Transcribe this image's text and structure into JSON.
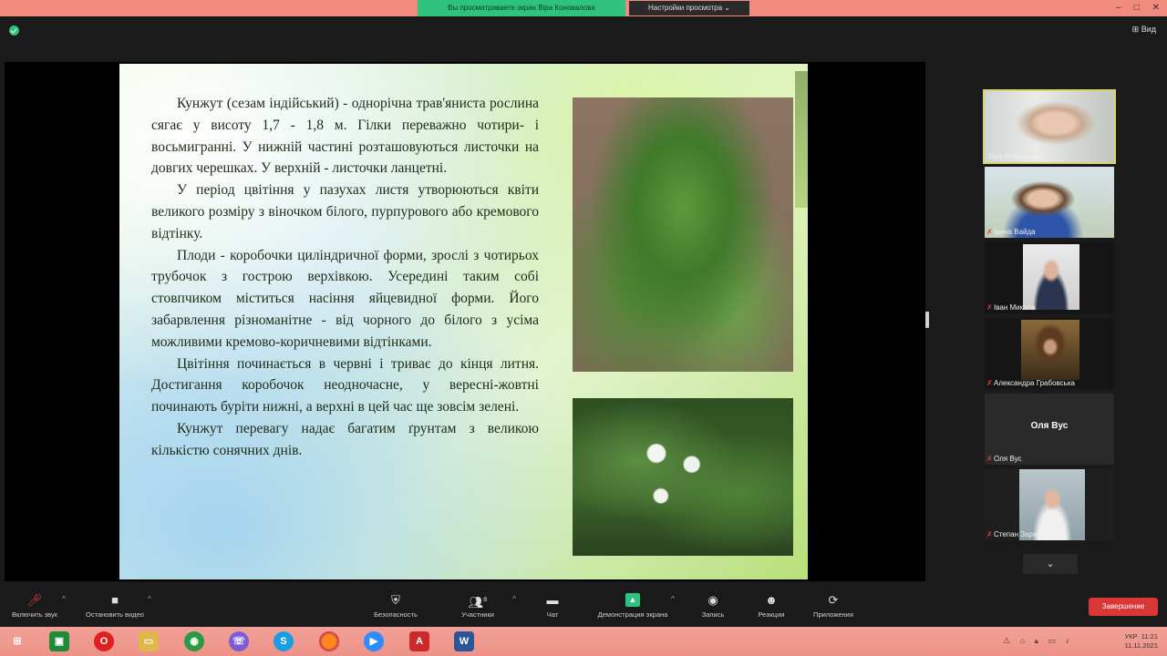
{
  "topbar": {
    "share_banner": "Вы просматриваете экран Віра Коновалова",
    "view_options": "Настройки просмотра",
    "view_options_caret": "⌄",
    "window_controls": [
      "–",
      "□",
      "✕"
    ]
  },
  "zoom": {
    "view_label": "⊞ Вид"
  },
  "slide": {
    "paragraphs": [
      "Кунжут (сезам індійський) - однорічна трав'яниста рослина сягає у висоту 1,7 - 1,8 м. Гілки переважно чотири- і восьмигранні. У нижній частині розташовуються листочки на довгих черешках. У верхній - листочки ланцетні.",
      "У період цвітіння у пазухах листя утворюються квіти великого розміру з віночком білого, пурпурового або кремового відтінку.",
      "Плоди - коробочки циліндричної форми, зрослі з чотирьох трубочок з гострою верхівкою. Усередині таким собі стовпчиком міститься насіння яйцевидної форми.   Його забарвлення різноманітне - від чорного до білого з усіма можливими кремово-коричневими відтінками.",
      "Цвітіння починається в червні і триває до кінця литня. Достигання коробочок неодночасне, у вересні-жовтні починають буріти нижні, а верхні в цей час ще зовсім зелені.",
      "Кунжут перевагу надає багатим ґрунтам з великою кількістю сонячних днів."
    ]
  },
  "participants": [
    {
      "name": "Віра Коновалова",
      "active": true,
      "muted": false
    },
    {
      "name": "Ірина Вайда",
      "active": false,
      "muted": true
    },
    {
      "name": "Іван Микола",
      "active": false,
      "muted": true
    },
    {
      "name": "Александра Грабовська",
      "active": false,
      "muted": true
    },
    {
      "name": "Оля Вус",
      "active": false,
      "muted": true,
      "center_name": "Оля Вус"
    },
    {
      "name": "Степан Зарицький",
      "active": false,
      "muted": true
    }
  ],
  "scroll_down": "⌄",
  "toolbar": {
    "mute": "Включить звук",
    "video": "Остановить видео",
    "security": "Безопасность",
    "participants": "Участники",
    "participants_count": "8",
    "chat": "Чат",
    "share": "Демонстрация экрана",
    "record": "Запись",
    "reactions": "Реакции",
    "apps": "Приложения",
    "end": "Завершение"
  },
  "taskbar": {
    "time": "11:21",
    "date": "11.11.2021",
    "lang": "УКР"
  }
}
